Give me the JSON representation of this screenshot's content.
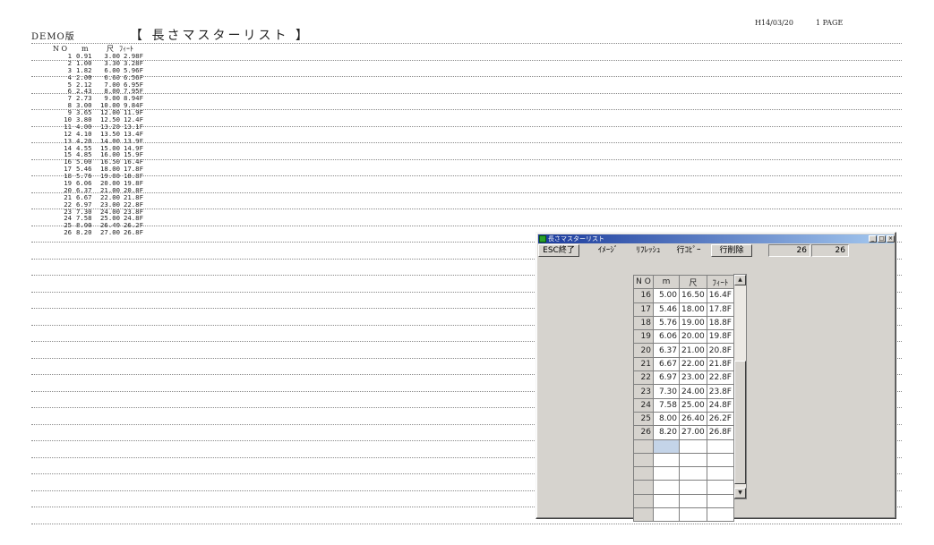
{
  "report": {
    "edition": "DEMO版",
    "title": "【 長さマスターリスト 】",
    "date": "H14/03/20",
    "page": "1 PAGE",
    "columns": {
      "no": "N O",
      "m": "m",
      "shaku": "尺",
      "feet": "ﾌｨｰﾄ"
    },
    "rows": [
      [
        "1",
        "0.91",
        "3.00",
        "2.98F"
      ],
      [
        "2",
        "1.00",
        "3.30",
        "3.28F"
      ],
      [
        "3",
        "1.82",
        "6.00",
        "5.96F"
      ],
      [
        "4",
        "2.00",
        "6.60",
        "6.56F"
      ],
      [
        "5",
        "2.12",
        "7.00",
        "6.95F"
      ],
      [
        "6",
        "2.43",
        "8.00",
        "7.95F"
      ],
      [
        "7",
        "2.73",
        "9.00",
        "8.94F"
      ],
      [
        "8",
        "3.00",
        "10.00",
        "9.84F"
      ],
      [
        "9",
        "3.65",
        "12.00",
        "11.9F"
      ],
      [
        "10",
        "3.80",
        "12.50",
        "12.4F"
      ],
      [
        "11",
        "4.00",
        "13.20",
        "13.1F"
      ],
      [
        "12",
        "4.10",
        "13.50",
        "13.4F"
      ],
      [
        "13",
        "4.20",
        "14.00",
        "13.9F"
      ],
      [
        "14",
        "4.55",
        "15.00",
        "14.9F"
      ],
      [
        "15",
        "4.85",
        "16.00",
        "15.9F"
      ],
      [
        "16",
        "5.00",
        "16.50",
        "16.4F"
      ],
      [
        "17",
        "5.46",
        "18.00",
        "17.8F"
      ],
      [
        "18",
        "5.76",
        "19.00",
        "18.8F"
      ],
      [
        "19",
        "6.06",
        "20.00",
        "19.8F"
      ],
      [
        "20",
        "6.37",
        "21.00",
        "20.8F"
      ],
      [
        "21",
        "6.67",
        "22.00",
        "21.8F"
      ],
      [
        "22",
        "6.97",
        "23.00",
        "22.8F"
      ],
      [
        "23",
        "7.30",
        "24.00",
        "23.8F"
      ],
      [
        "24",
        "7.58",
        "25.00",
        "24.8F"
      ],
      [
        "25",
        "8.00",
        "26.40",
        "26.2F"
      ],
      [
        "26",
        "8.20",
        "27.00",
        "26.8F"
      ]
    ]
  },
  "window": {
    "title": "長さマスターリスト",
    "controls": {
      "minimize": "_",
      "maximize": "□",
      "close": "×"
    },
    "toolbar": {
      "exit": "ESC終了",
      "image": "ｲﾒｰｼﾞ",
      "refresh": "ﾘﾌﾚｯｼｭ",
      "copy_row": "行ｺﾋﾟｰ",
      "delete_row": "行削除"
    },
    "counter": {
      "current": "26",
      "total": "26"
    },
    "grid": {
      "headers": [
        "N O",
        "m",
        "尺",
        "ﾌｨｰﾄ"
      ],
      "rows": [
        [
          "16",
          "5.00",
          "16.50",
          "16.4F"
        ],
        [
          "17",
          "5.46",
          "18.00",
          "17.8F"
        ],
        [
          "18",
          "5.76",
          "19.00",
          "18.8F"
        ],
        [
          "19",
          "6.06",
          "20.00",
          "19.8F"
        ],
        [
          "20",
          "6.37",
          "21.00",
          "20.8F"
        ],
        [
          "21",
          "6.67",
          "22.00",
          "21.8F"
        ],
        [
          "22",
          "6.97",
          "23.00",
          "22.8F"
        ],
        [
          "23",
          "7.30",
          "24.00",
          "23.8F"
        ],
        [
          "24",
          "7.58",
          "25.00",
          "24.8F"
        ],
        [
          "25",
          "8.00",
          "26.40",
          "26.2F"
        ],
        [
          "26",
          "8.20",
          "27.00",
          "26.8F"
        ]
      ],
      "empty_rows": 6
    },
    "scrollbar": {
      "up": "▲",
      "down": "▼"
    }
  }
}
